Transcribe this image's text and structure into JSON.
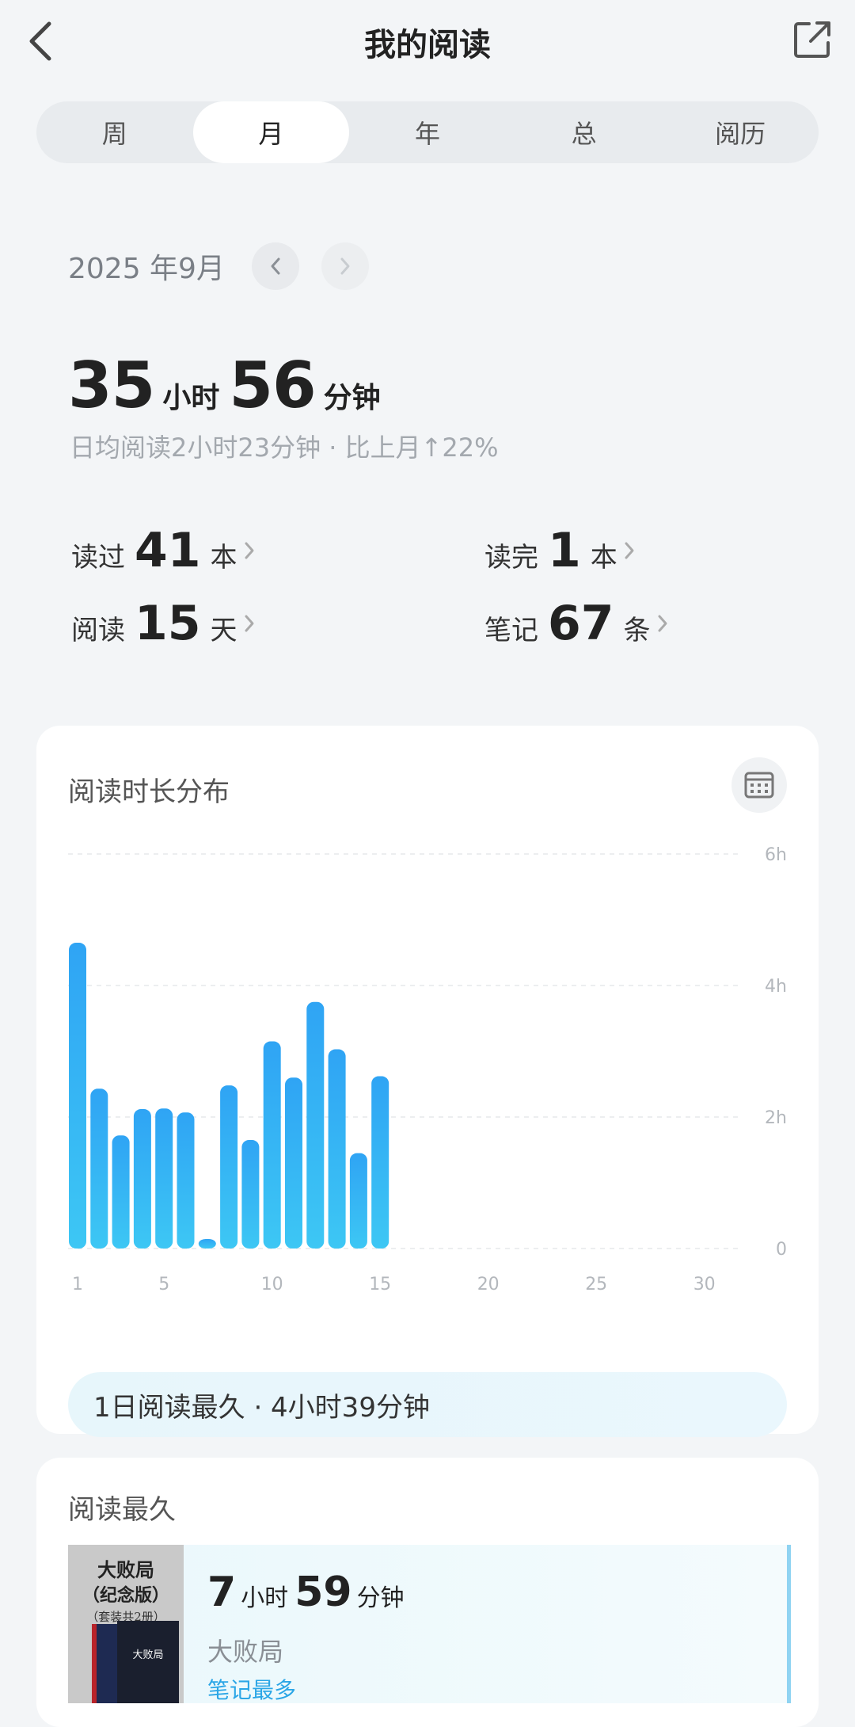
{
  "header": {
    "title": "我的阅读"
  },
  "tabs": [
    {
      "label": "周",
      "active": false
    },
    {
      "label": "月",
      "active": true
    },
    {
      "label": "年",
      "active": false
    },
    {
      "label": "总",
      "active": false
    },
    {
      "label": "阅历",
      "active": false
    }
  ],
  "period": {
    "label": "2025 年9月"
  },
  "total": {
    "hours": "35",
    "hours_unit": "小时",
    "minutes": "56",
    "minutes_unit": "分钟",
    "summary": "日均阅读2小时23分钟 · 比上月↑22%"
  },
  "stats": {
    "read": {
      "label": "读过",
      "value": "41",
      "unit": "本"
    },
    "finished": {
      "label": "读完",
      "value": "1",
      "unit": "本"
    },
    "days": {
      "label": "阅读",
      "value": "15",
      "unit": "天"
    },
    "notes": {
      "label": "笔记",
      "value": "67",
      "unit": "条"
    }
  },
  "distribution_card": {
    "title": "阅读时长分布",
    "highlight": "1日阅读最久 · 4小时39分钟"
  },
  "chart_data": {
    "type": "bar",
    "x": [
      1,
      2,
      3,
      4,
      5,
      6,
      7,
      8,
      9,
      10,
      11,
      12,
      13,
      14,
      15
    ],
    "values": [
      4.65,
      2.43,
      1.72,
      2.12,
      2.13,
      2.07,
      0.12,
      2.48,
      1.65,
      3.15,
      2.6,
      3.75,
      3.03,
      1.45,
      2.62
    ],
    "x_ticks": [
      "1",
      "5",
      "10",
      "15",
      "20",
      "25",
      "30"
    ],
    "x_tick_values": [
      1,
      5,
      10,
      15,
      20,
      25,
      30
    ],
    "y_ticks": [
      "6h",
      "4h",
      "2h",
      "0"
    ],
    "y_tick_values": [
      6,
      4,
      2,
      0
    ],
    "xlim": [
      1,
      30
    ],
    "ylim": [
      0,
      6
    ],
    "grid": true,
    "bar_color_top": "#2fa4f4",
    "bar_color_bottom": "#3dc7f4"
  },
  "longest_card": {
    "title": "阅读最久",
    "book": {
      "cover_title": "大败局",
      "cover_edition": "（纪念版）",
      "cover_set": "（套装共2册）",
      "cover_spine": "大败局",
      "hours": "7",
      "hours_unit": "小时",
      "minutes": "59",
      "minutes_unit": "分钟",
      "name": "大败局",
      "tag": "笔记最多"
    }
  }
}
